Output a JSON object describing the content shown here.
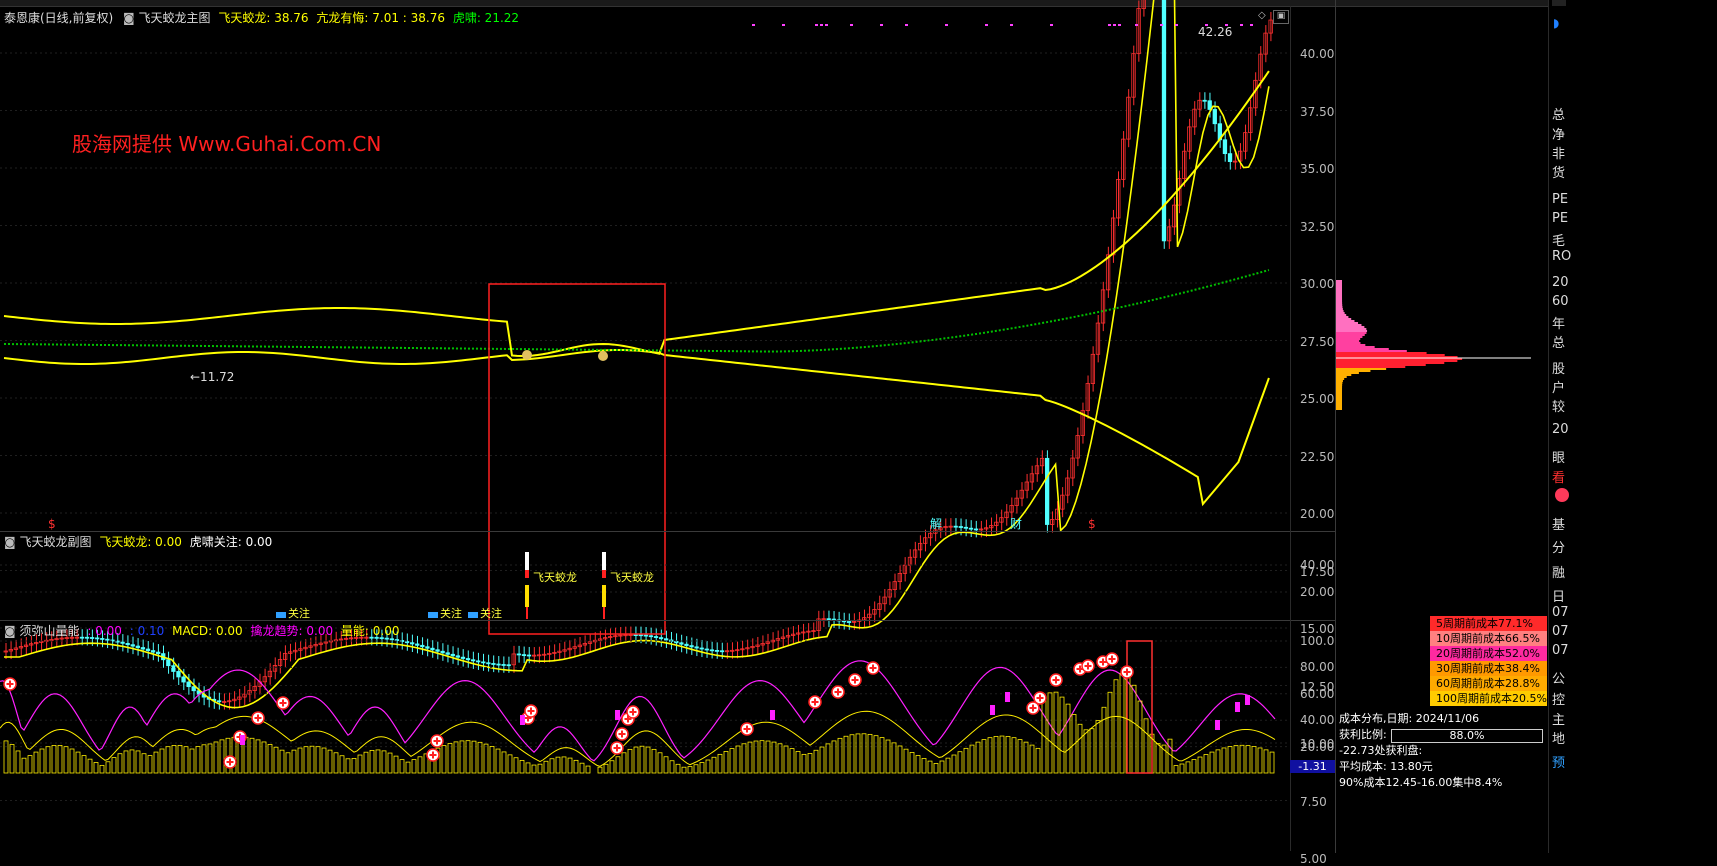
{
  "main_panel": {
    "stock_title": "泰恩康(日线,前复权)",
    "indicator_name": "飞天蛟龙主图",
    "legend": [
      {
        "label": "飞天蛟龙: 38.76",
        "color": "#ffff00"
      },
      {
        "label": "亢龙有悔: 7.01 : 38.76",
        "color": "#ffff00"
      },
      {
        "label": "虎啸: 21.22",
        "color": "#00ff00"
      }
    ],
    "watermark": "股海网提供 Www.Guhai.Com.CN",
    "high_label": "42.26",
    "low_label": "←11.72",
    "event_markers": [
      "$",
      "解",
      "财",
      "$"
    ],
    "y_ticks": [
      "40.00",
      "37.50",
      "35.00",
      "32.50",
      "30.00",
      "27.50",
      "25.00",
      "22.50",
      "20.00",
      "17.50",
      "15.00",
      "12.50",
      "10.00",
      "7.50",
      "5.00"
    ]
  },
  "sub_panel": {
    "name": "飞天蛟龙副图",
    "legend": [
      {
        "label": "飞天蛟龙: 0.00",
        "color": "#ffff00"
      },
      {
        "label": "虎啸关注: 0.00",
        "color": "#ffffff"
      }
    ],
    "signal_labels": [
      "飞天蛟龙",
      "飞天蛟龙"
    ],
    "focus_labels": [
      "关注",
      "关注",
      "关注"
    ],
    "y_ticks": [
      "40.00",
      "20.00"
    ]
  },
  "bottom_panel": {
    "name": "须弥山量能",
    "legend": [
      {
        "label": ": 0.00",
        "color": "#ff00ff"
      },
      {
        "label": ": 0.10",
        "color": "#0000ff"
      },
      {
        "label": "MACD: 0.00",
        "color": "#ffff00"
      },
      {
        "label": "擒龙趋势: 0.00",
        "color": "#ff00ff"
      },
      {
        "label": "量能: 0.00",
        "color": "#ffff00"
      }
    ],
    "y_ticks": [
      "100.0",
      "80.00",
      "60.00",
      "40.00",
      "20.00"
    ],
    "current_value": "-1.31"
  },
  "cost_distribution": {
    "title": "成本分布,日期: 2024/11/06",
    "profit_label": "获利比例:",
    "profit_value": "88.0%",
    "profit_fraction": 0.88,
    "profit_price": "-22.73处获利盘:",
    "avg_cost": "平均成本: 13.80元",
    "concentration": "90%成本12.45-16.00集中8.4%",
    "period_rows": [
      {
        "label": "5周期前成本77.1%",
        "color": "#ff2a2a"
      },
      {
        "label": "10周期前成本66.5%",
        "color": "#ff8080"
      },
      {
        "label": "20周期前成本52.0%",
        "color": "#ff2aa0"
      },
      {
        "label": "30周期前成本38.4%",
        "color": "#ff9900"
      },
      {
        "label": "60周期前成本28.8%",
        "color": "#ffaa00"
      },
      {
        "label": "100周期前成本20.5%",
        "color": "#ffcc00"
      }
    ]
  },
  "right_sidebar": {
    "items": [
      "总",
      "净",
      "非",
      "货",
      "PE",
      "PE",
      "毛",
      "RO",
      "20",
      "60",
      "年",
      "总",
      "股",
      "户",
      "较",
      "20",
      "眼",
      "看",
      "基",
      "分",
      "融",
      "日",
      "07",
      "07",
      "07",
      "公",
      "控",
      "主",
      "地",
      "预"
    ]
  },
  "colors": {
    "up": "#ff3030",
    "down": "#50ffff",
    "yellow_line": "#ffff00",
    "green_dots": "#00c000",
    "box": "#ff2020"
  }
}
